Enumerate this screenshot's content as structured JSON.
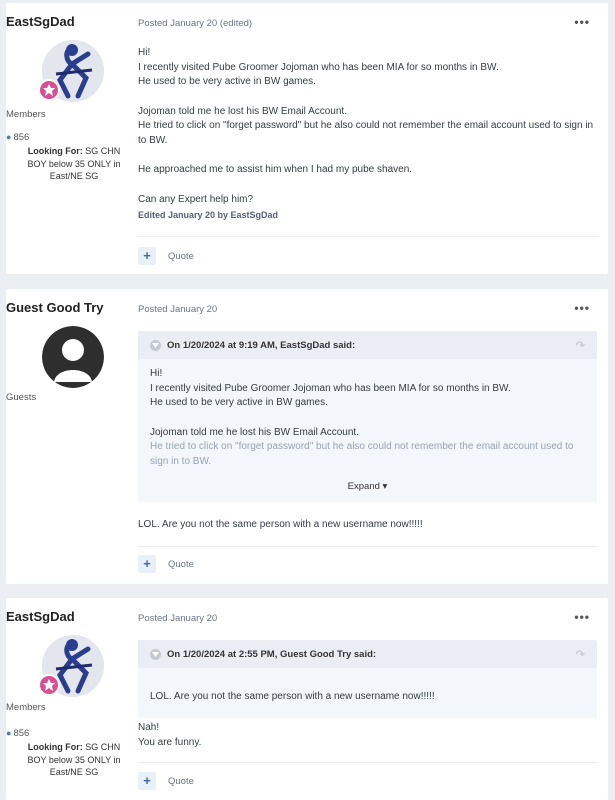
{
  "posts": [
    {
      "author": "EastSgDad",
      "group": "Members",
      "count": "856",
      "looking_for_label": "Looking For:",
      "looking_for_value": "SG CHN BOY below 35 ONLY in East/NE SG",
      "meta": "Posted January 20 (edited)",
      "more": "•••",
      "body": [
        "Hi!",
        "I recently visited Pube Groomer Jojoman who has been MIA for so months in BW.",
        "He used to be very active in BW games.",
        "Jojoman told me he lost his BW Email Account.",
        "He tried to click on \"forget password\" but he also could not remember the email account used to sign in to BW.",
        "He approached me to assist him when I had my pube shaven.",
        "Can any Expert help him?"
      ],
      "edited": "Edited January 20 by EastSgDad",
      "plus": "+",
      "quote": "Quote"
    },
    {
      "author": "Guest Good Try",
      "group": "Guests",
      "meta": "Posted January 20",
      "more": "•••",
      "quote_header": "On 1/20/2024 at 9:19 AM, EastSgDad said:",
      "quote_lines": [
        "Hi!",
        "I recently visited Pube Groomer Jojoman who has been MIA for so months in BW.",
        "He used to be very active in BW games.",
        "Jojoman told me he lost his BW Email Account.",
        "He tried to click on \"forget password\" but he also could not remember the email account used to sign in to BW."
      ],
      "expand": "Expand",
      "body": [
        "LOL.  Are you not the same person with a new username now!!!!!"
      ],
      "plus": "+",
      "quote": "Quote"
    },
    {
      "author": "EastSgDad",
      "group": "Members",
      "count": "856",
      "looking_for_label": "Looking For:",
      "looking_for_value": "SG CHN BOY below 35 ONLY in East/NE SG",
      "meta": "Posted January 20",
      "more": "•••",
      "quote_header": "On 1/20/2024 at 2:55 PM, Guest Good Try said:",
      "quote_lines": [
        "LOL.  Are you not the same person with a new username now!!!!!"
      ],
      "body": [
        "Nah!",
        "You are funny."
      ],
      "plus": "+",
      "quote": "Quote"
    }
  ]
}
